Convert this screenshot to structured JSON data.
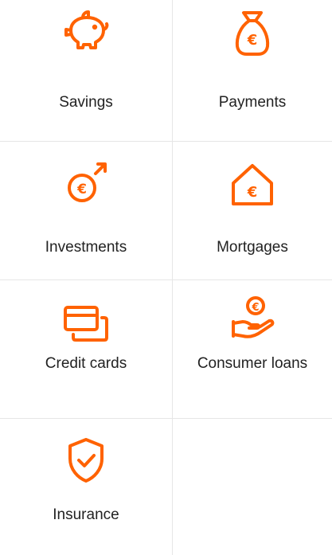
{
  "accent_color": "#ff6200",
  "products": [
    {
      "label": "Savings",
      "icon": "piggy-bank-icon"
    },
    {
      "label": "Payments",
      "icon": "money-bag-euro-icon"
    },
    {
      "label": "Investments",
      "icon": "euro-coin-arrow-up-icon"
    },
    {
      "label": "Mortgages",
      "icon": "house-euro-icon"
    },
    {
      "label": "Credit cards",
      "icon": "credit-cards-icon"
    },
    {
      "label": "Consumer loans",
      "icon": "hand-euro-coin-icon"
    },
    {
      "label": "Insurance",
      "icon": "shield-check-icon"
    }
  ]
}
